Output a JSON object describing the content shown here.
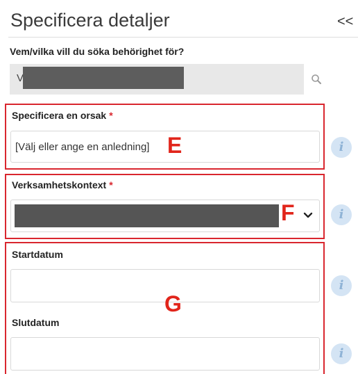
{
  "header": {
    "title": "Specificera detaljer",
    "collapse_label": "<<"
  },
  "who": {
    "label": "Vem/vilka vill du söka behörighet för?",
    "value_prefix": "V",
    "search_icon": "search-icon"
  },
  "reason": {
    "label": "Specificera en orsak",
    "required_mark": "*",
    "value": "[Välj eller ange en anledning]",
    "callout_letter": "E",
    "info_icon": "info-icon"
  },
  "context": {
    "label": "Verksamhetskontext",
    "required_mark": "*",
    "callout_letter": "F",
    "dropdown_icon": "chevron-down-icon",
    "info_icon": "info-icon"
  },
  "dates": {
    "callout_letter": "G",
    "start_label": "Startdatum",
    "end_label": "Slutdatum",
    "info_icon": "info-icon"
  },
  "info_glyph": "i",
  "colors": {
    "callout_border": "#d9262e",
    "callout_letter": "#e1251b",
    "info_bg": "#d4e4f4",
    "info_fg": "#8fb3d6",
    "redaction": "#5d5d5d"
  }
}
